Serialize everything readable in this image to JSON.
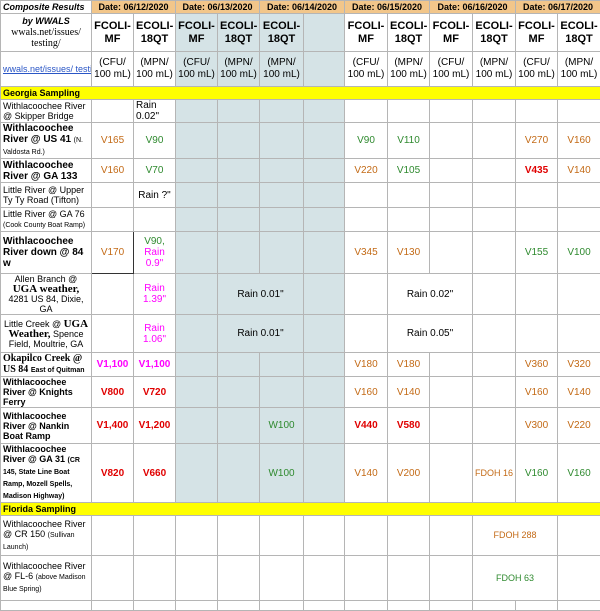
{
  "header": {
    "title": "Composite Results",
    "byline": "by WWALS",
    "site_text": "wwals.net/issues/ testing/",
    "url_short": "wwals.net/issues/ testi",
    "dates": [
      "Date: 06/12/2020",
      "Date: 06/13/2020",
      "Date: 06/14/2020",
      "Date: 06/15/2020",
      "Date: 06/16/2020",
      "Date: 06/17/2020"
    ]
  },
  "params": [
    "FCOLI-MF",
    "ECOLI-18QT",
    "FCOLI-MF",
    "ECOLI-18QT",
    "ECOLI-18QT",
    "FCOLI-MF",
    "ECOLI-18QT",
    "FCOLI-MF",
    "ECOLI-18QT",
    "FCOLI-MF",
    "ECOLI-18QT"
  ],
  "units": [
    "(CFU/ 100 mL)",
    "(MPN/ 100 mL)",
    "(CFU/ 100 mL)",
    "(MPN/ 100 mL)",
    "(MPN/ 100 mL)",
    "(CFU/ 100 mL)",
    "(MPN/ 100 mL)",
    "(CFU/ 100 mL)",
    "(MPN/ 100 mL)",
    "(CFU/ 100 mL)",
    "(MPN/ 100 mL)"
  ],
  "sections": {
    "georgia": "Georgia Sampling",
    "florida": "Florida Sampling"
  },
  "rows": {
    "skipper": {
      "name": "Withlacoochee River @ Skipper Bridge",
      "c2": "Rain 0.02\""
    },
    "us41": {
      "name": "Withlacoochee River @ US 41",
      "sub": "(N. Valdosta Rd.)",
      "c1": "V165",
      "c2": "V90",
      "c6": "V90",
      "c7": "V110",
      "c10": "V270",
      "c11": "V160"
    },
    "ga133": {
      "name": "Withlacoochee River @ GA 133",
      "c1": "V160",
      "c2": "V70",
      "c6": "V220",
      "c7": "V105",
      "c10": "V435",
      "c11": "V140"
    },
    "little_tifton": {
      "name": "Little River @ Upper Ty Ty Road (Tifton)",
      "c2": "Rain ?\""
    },
    "little_ga76": {
      "name": "Little River @ GA 76",
      "sub": "(Cook County Boat Ramp)"
    },
    "down84": {
      "name": "Withlacoochee River down @ 84 w",
      "c1": "V170",
      "c2a": "V90,",
      "c2b": "Rain 0.9\"",
      "c6": "V345",
      "c7": "V130",
      "c10": "V155",
      "c11": "V100"
    },
    "allen": {
      "name1": "Allen Branch @",
      "uga": "UGA",
      "weather": "weather,",
      "name2": "4281 US 84, Dixie, GA",
      "c2": "Rain 1.39\"",
      "c4": "Rain 0.01\"",
      "c7": "Rain 0.02\""
    },
    "littlecreek": {
      "name1": "Little Creek @",
      "uga": "UGA",
      "weather": "Weather,",
      "name2": "Spence Field, Moultrie, GA",
      "c2": "Rain 1.06\"",
      "c4": "Rain 0.01\"",
      "c7": "Rain 0.05\""
    },
    "okapilco": {
      "name1": "Okapilco Creek @ US 84",
      "sub": "East of Quitman",
      "c1": "V1,100",
      "c2": "V1,100",
      "c6": "V180",
      "c7": "V180",
      "c10": "V360",
      "c11": "V320"
    },
    "knights": {
      "name": "Withlacoochee River @ Knights Ferry",
      "c1": "V800",
      "c2": "V720",
      "c6": "V160",
      "c7": "V140",
      "c10": "V160",
      "c11": "V140"
    },
    "nankin": {
      "name": "Withlacoochee River @ Nankin Boat Ramp",
      "c1": "V1,400",
      "c2": "V1,200",
      "c5": "W100",
      "c6": "V440",
      "c7": "V580",
      "c10": "V300",
      "c11": "V220"
    },
    "ga31": {
      "name": "Withlacoochee River @ GA 31",
      "sub": "(CR 145, State Line Boat Ramp, Mozell Spells, Madison Highway)",
      "c1": "V820",
      "c2": "V660",
      "c5": "W100",
      "c6": "V140",
      "c7": "V200",
      "c9": "FDOH 16",
      "c10": "V160",
      "c11": "V160"
    },
    "cr150": {
      "name": "Withlacoochee River @ CR 150",
      "sub": "(Sullivan Launch)",
      "c9": "FDOH 288"
    },
    "fl6": {
      "name": "Withlacoochee River @ FL-6",
      "sub": "(above Madison Blue Spring)",
      "c9": "FDOH 63"
    }
  },
  "colors": {
    "date_header": "#f2c68a",
    "gap_column": "#d5e3e6",
    "section": "#ffff00",
    "orange": "#c36a16",
    "green": "#2f8a2f",
    "red": "#e00000",
    "magenta": "#ff00ff"
  }
}
